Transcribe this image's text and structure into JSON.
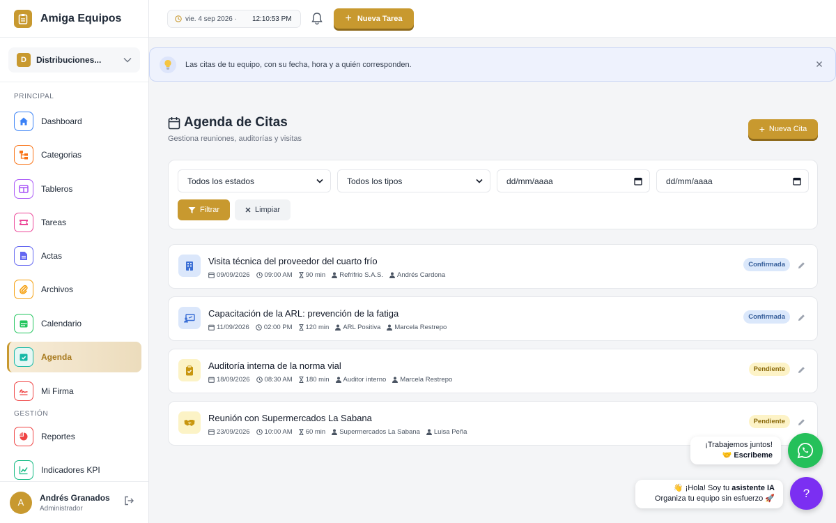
{
  "brand": {
    "name": "Amiga Equipos",
    "logo_icon": "clipboard-icon",
    "color": "#c8992f"
  },
  "org": {
    "badge": "D",
    "name": "Distribuciones..."
  },
  "sidebar": {
    "section_main": "PRINCIPAL",
    "section_management": "GESTIÓN",
    "items": [
      {
        "label": "Dashboard",
        "icon": "home-icon",
        "color": "#3b82f6"
      },
      {
        "label": "Categorias",
        "icon": "sitemap-icon",
        "color": "#f97316"
      },
      {
        "label": "Tableros",
        "icon": "columns-icon",
        "color": "#a855f7"
      },
      {
        "label": "Tareas",
        "icon": "ticket-icon",
        "color": "#ec4899"
      },
      {
        "label": "Actas",
        "icon": "document-icon",
        "color": "#6366f1"
      },
      {
        "label": "Archivos",
        "icon": "paperclip-icon",
        "color": "#f59e0b"
      },
      {
        "label": "Calendario",
        "icon": "calendar-icon",
        "color": "#22c55e"
      },
      {
        "label": "Agenda",
        "icon": "calendar-check-icon",
        "color": "#14b8a6"
      },
      {
        "label": "Mi Firma",
        "icon": "signature-icon",
        "color": "#ef4444"
      },
      {
        "label": "Reportes",
        "icon": "pie-chart-icon",
        "color": "#ef4444"
      },
      {
        "label": "Indicadores KPI",
        "icon": "line-chart-icon",
        "color": "#10b981"
      }
    ],
    "active": "Agenda"
  },
  "user": {
    "initial": "A",
    "name": "Andrés Granados",
    "role": "Administrador"
  },
  "topbar": {
    "date": "vie. 4 sep 2026 ·",
    "time": "12:10:53 PM",
    "new_task": "Nueva Tarea"
  },
  "banner": {
    "text": "Las citas de tu equipo, con su fecha, hora y a quién corresponden."
  },
  "page": {
    "title": "Agenda de Citas",
    "subtitle": "Gestiona reuniones, auditorías y visitas",
    "new_button": "Nueva Cita"
  },
  "filters": {
    "status": "Todos los estados",
    "type": "Todos los tipos",
    "date_from_placeholder": "dd/mm/aaaa",
    "date_to_placeholder": "dd/mm/aaaa",
    "filter_button": "Filtrar",
    "clear_button": "Limpiar"
  },
  "appointments": [
    {
      "title": "Visita técnica del proveedor del cuarto frío",
      "date": "09/09/2026",
      "time": "09:00 AM",
      "duration": "90 min",
      "company": "Refrifrio S.A.S.",
      "person": "Andrés Cardona",
      "status": "Confirmada",
      "icon": "building-icon"
    },
    {
      "title": "Capacitación de la ARL: prevención de la fatiga",
      "date": "11/09/2026",
      "time": "02:00 PM",
      "duration": "120 min",
      "company": "ARL Positiva",
      "person": "Marcela Restrepo",
      "status": "Confirmada",
      "icon": "presentation-icon"
    },
    {
      "title": "Auditoría interna de la norma vial",
      "date": "18/09/2026",
      "time": "08:30 AM",
      "duration": "180 min",
      "company": "Auditor interno",
      "person": "Marcela Restrepo",
      "status": "Pendiente",
      "icon": "clipboard-check-icon"
    },
    {
      "title": "Reunión con Supermercados La Sabana",
      "date": "23/09/2026",
      "time": "10:00 AM",
      "duration": "60 min",
      "company": "Supermercados La Sabana",
      "person": "Luisa Peña",
      "status": "Pendiente",
      "icon": "handshake-icon"
    }
  ],
  "helpers": {
    "whatsapp_line1": "¡Trabajemos juntos!",
    "whatsapp_line2": "🤝 Escribeme",
    "ai_line1_prefix": "👋 ¡Hola! Soy tu ",
    "ai_line1_bold": "asistente IA",
    "ai_line2": "Organiza tu equipo sin esfuerzo 🚀",
    "ai_button": "?"
  }
}
